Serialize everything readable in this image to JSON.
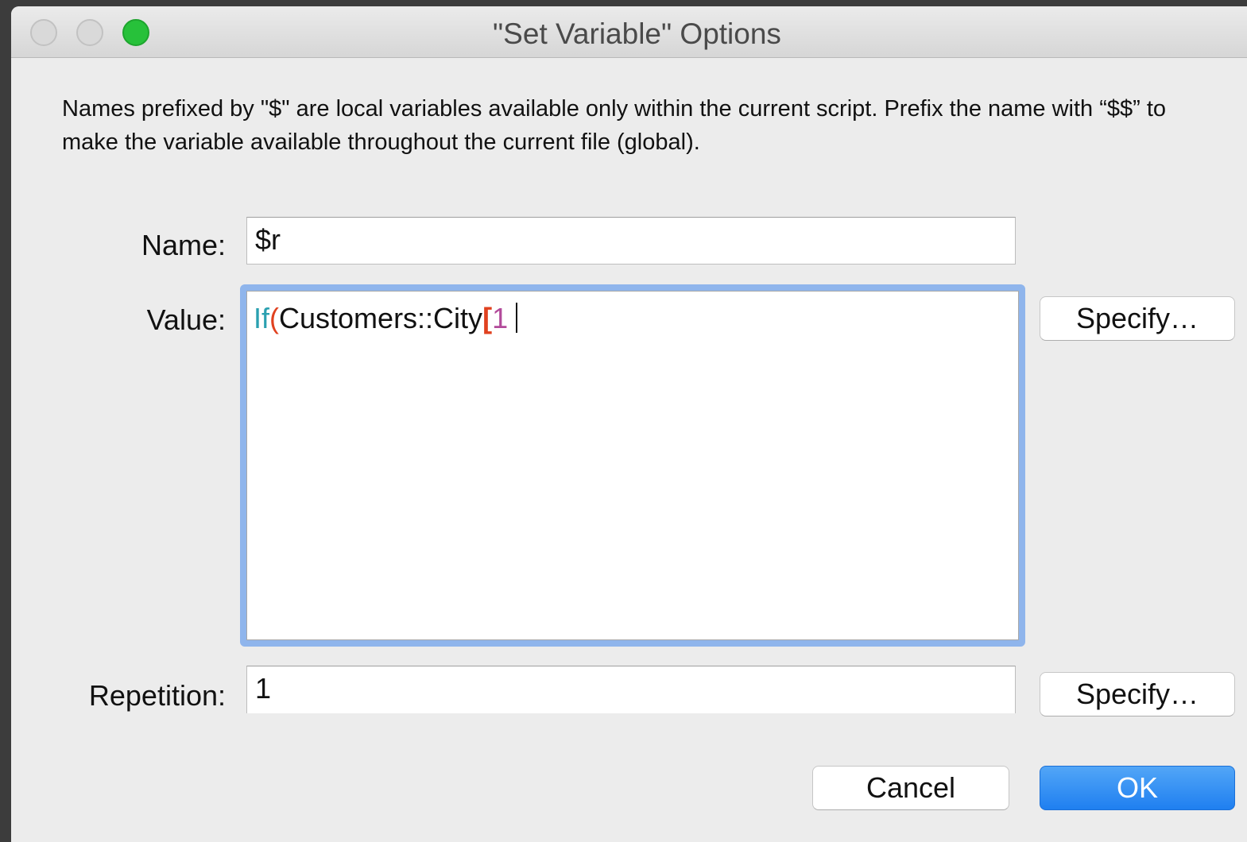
{
  "window": {
    "title": "\"Set Variable\" Options"
  },
  "description": "Names prefixed by \"$\" are local variables available only within the current script. Prefix the name with “$$” to make the variable available throughout the current file (global).",
  "name_field": {
    "label": "Name:",
    "value": "$r"
  },
  "value_field": {
    "label": "Value:",
    "tokens": {
      "function": "If",
      "open_paren": "(",
      "field_ref": "Customers::City",
      "open_bracket": "[",
      "number": "1"
    }
  },
  "repetition_field": {
    "label": "Repetition:",
    "value": "1"
  },
  "buttons": {
    "specify_value": "Specify…",
    "specify_repetition": "Specify…",
    "cancel": "Cancel",
    "ok": "OK"
  },
  "colors": {
    "accent": "#1f7ff0",
    "focus_ring": "#8fb5ec",
    "zoom_button": "#27c13a",
    "syntax_function": "#2aa0b0",
    "syntax_bracket": "#e0411f",
    "syntax_number": "#b24a9a"
  }
}
